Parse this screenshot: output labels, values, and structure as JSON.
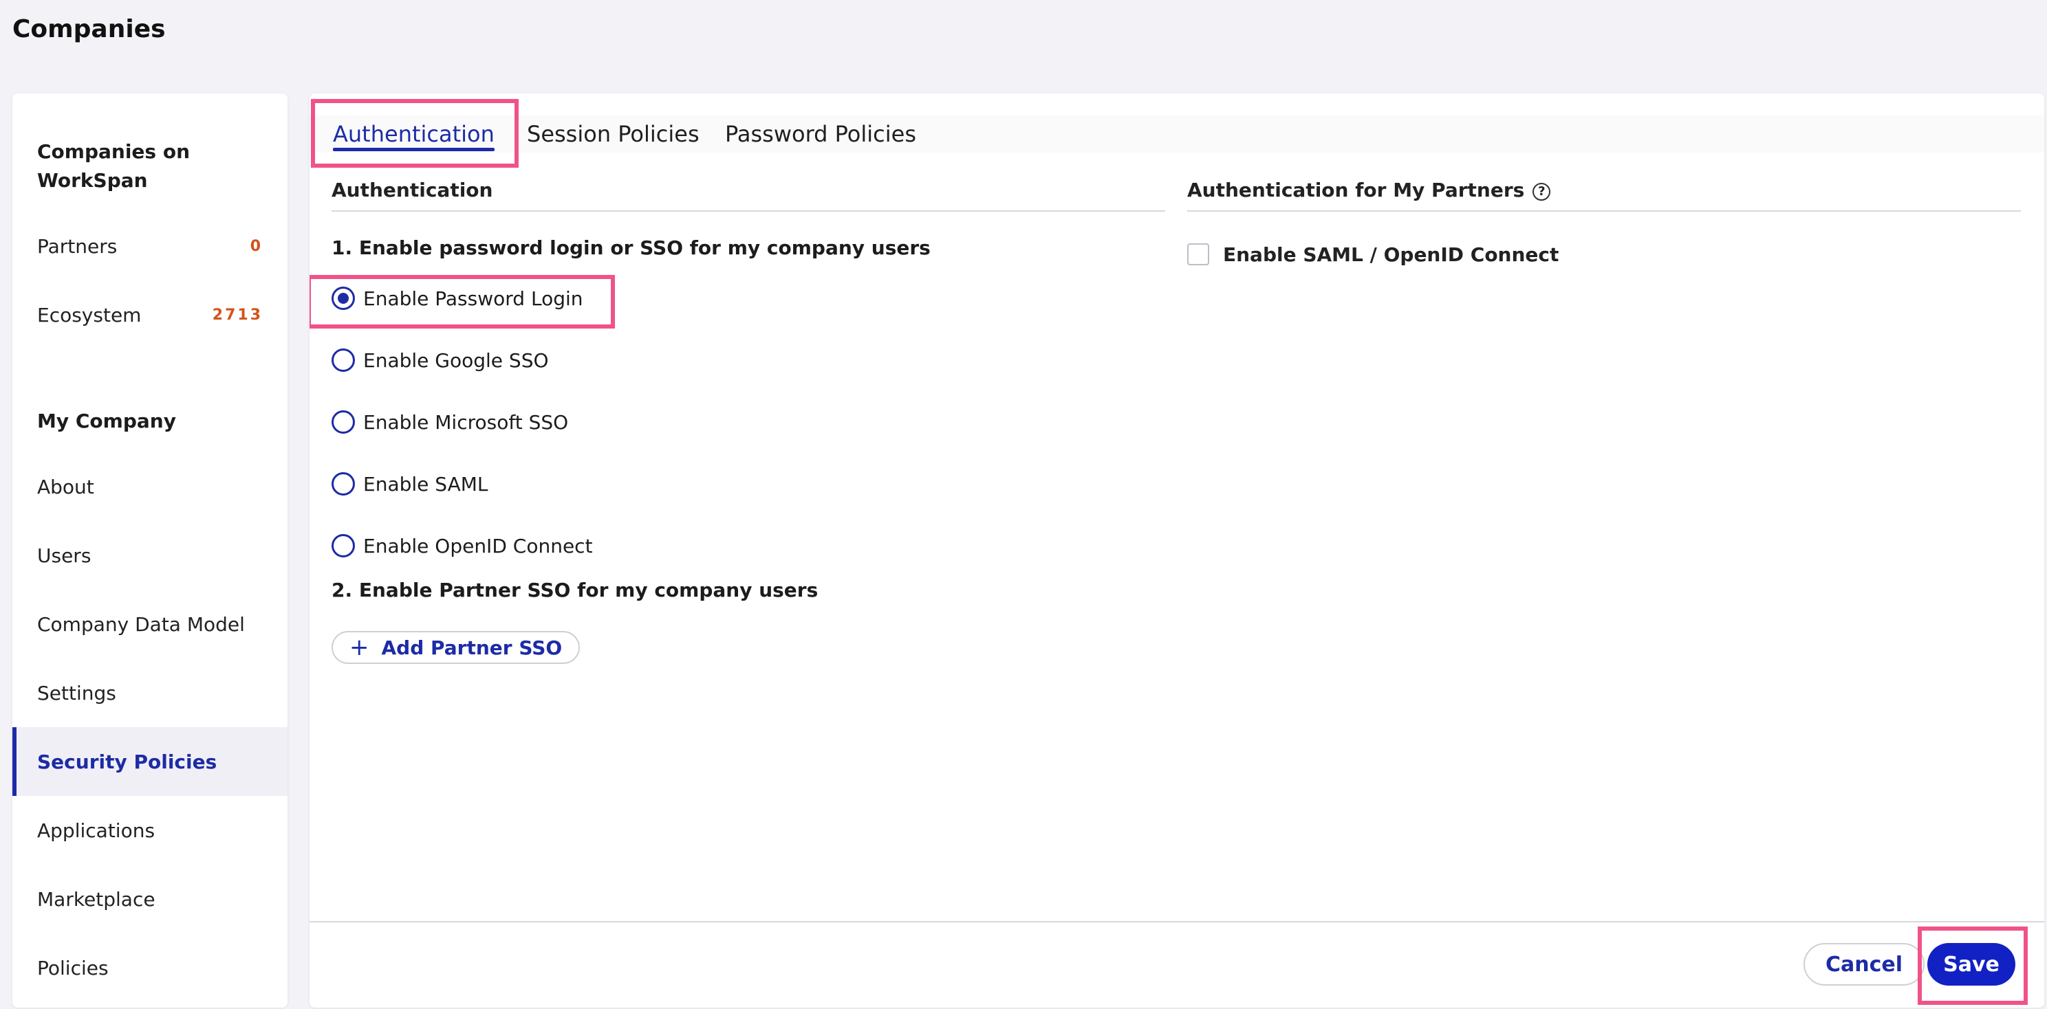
{
  "header": {
    "title": "Companies"
  },
  "sidebar": {
    "section1_heading": "Companies on WorkSpan",
    "partners": {
      "label": "Partners",
      "count": "0"
    },
    "ecosystem": {
      "label": "Ecosystem",
      "count": "2713"
    },
    "section2_heading": "My Company",
    "items": [
      {
        "label": "About"
      },
      {
        "label": "Users"
      },
      {
        "label": "Company Data Model"
      },
      {
        "label": "Settings"
      },
      {
        "label": "Security Policies",
        "active": true
      },
      {
        "label": "Applications"
      },
      {
        "label": "Marketplace"
      },
      {
        "label": "Policies"
      }
    ]
  },
  "tabs": [
    {
      "label": "Authentication",
      "active": true
    },
    {
      "label": "Session Policies"
    },
    {
      "label": "Password Policies"
    }
  ],
  "auth": {
    "section_heading": "Authentication",
    "step1_heading": "1. Enable password login or SSO for my company users",
    "options": [
      {
        "label": "Enable Password Login",
        "selected": true
      },
      {
        "label": "Enable Google SSO",
        "selected": false
      },
      {
        "label": "Enable Microsoft SSO",
        "selected": false
      },
      {
        "label": "Enable SAML",
        "selected": false
      },
      {
        "label": "Enable OpenID Connect",
        "selected": false
      }
    ],
    "step2_heading": "2. Enable Partner SSO for my company users",
    "add_partner_label": "Add Partner SSO"
  },
  "partners_auth": {
    "section_heading": "Authentication for My Partners",
    "help_icon": "question-circle-icon",
    "checkbox_label": "Enable SAML / OpenID Connect",
    "checked": false
  },
  "footer": {
    "cancel_label": "Cancel",
    "save_label": "Save"
  },
  "colors": {
    "accent": "#1d2ba6",
    "highlight": "#f05389",
    "count": "#d2541b",
    "save_bg": "#1221c4"
  }
}
